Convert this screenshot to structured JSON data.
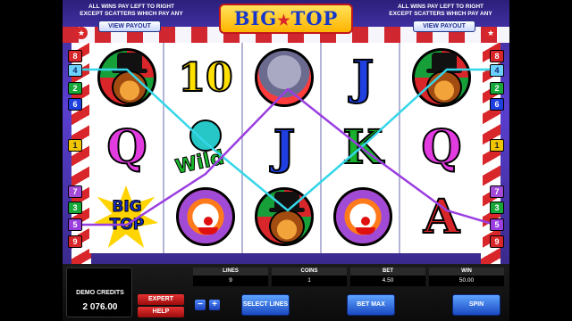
{
  "header": {
    "rules_left": "ALL WINS PAY LEFT TO RIGHT EXCEPT SCATTERS WHICH PAY ANY",
    "rules_right": "ALL WINS PAY LEFT TO RIGHT EXCEPT SCATTERS WHICH PAY ANY",
    "view_payout_left": "VIEW PAYOUT",
    "view_payout_right": "VIEW PAYOUT",
    "logo_big": "BIG",
    "logo_star": "★",
    "logo_top": "TOP"
  },
  "left_line_numbers": [
    "8",
    "4",
    "2",
    "6",
    "1",
    "7",
    "3",
    "5",
    "9"
  ],
  "right_line_numbers": [
    "8",
    "4",
    "2",
    "6",
    "1",
    "7",
    "3",
    "5",
    "9"
  ],
  "reels": [
    [
      "lion",
      "Q",
      "BIG TOP"
    ],
    [
      "10",
      "WILD",
      "clown"
    ],
    [
      "elephant",
      "J",
      "lion"
    ],
    [
      "J",
      "K",
      "clown"
    ],
    [
      "lion",
      "Q",
      "A"
    ]
  ],
  "symbols": {
    "q_letter": "Q",
    "j_letter": "J",
    "k_letter": "K",
    "a_letter": "A",
    "ten_label": "10",
    "wild_label": "Wild",
    "bigtop_line1": "BIG",
    "bigtop_line2": "TOP"
  },
  "colors": {
    "q": "#e23be0",
    "j": "#1f3fe0",
    "k": "#18b02c",
    "a": "#d8262a",
    "line_cyan": "#35d6e8",
    "line_purple": "#9a3ee0"
  },
  "panel": {
    "credits_label": "DEMO CREDITS",
    "credits_value": "2 076.00",
    "expert": "EXPERT",
    "help": "HELP",
    "minus": "−",
    "plus": "+",
    "lines_label": "LINES",
    "lines_value": "9",
    "coins_label": "COINS",
    "coins_value": "1",
    "bet_label": "BET",
    "bet_value": "4.50",
    "win_label": "WIN",
    "win_value": "50.00",
    "select_lines": "SELECT LINES",
    "bet_max": "BET MAX",
    "spin": "SPIN"
  }
}
